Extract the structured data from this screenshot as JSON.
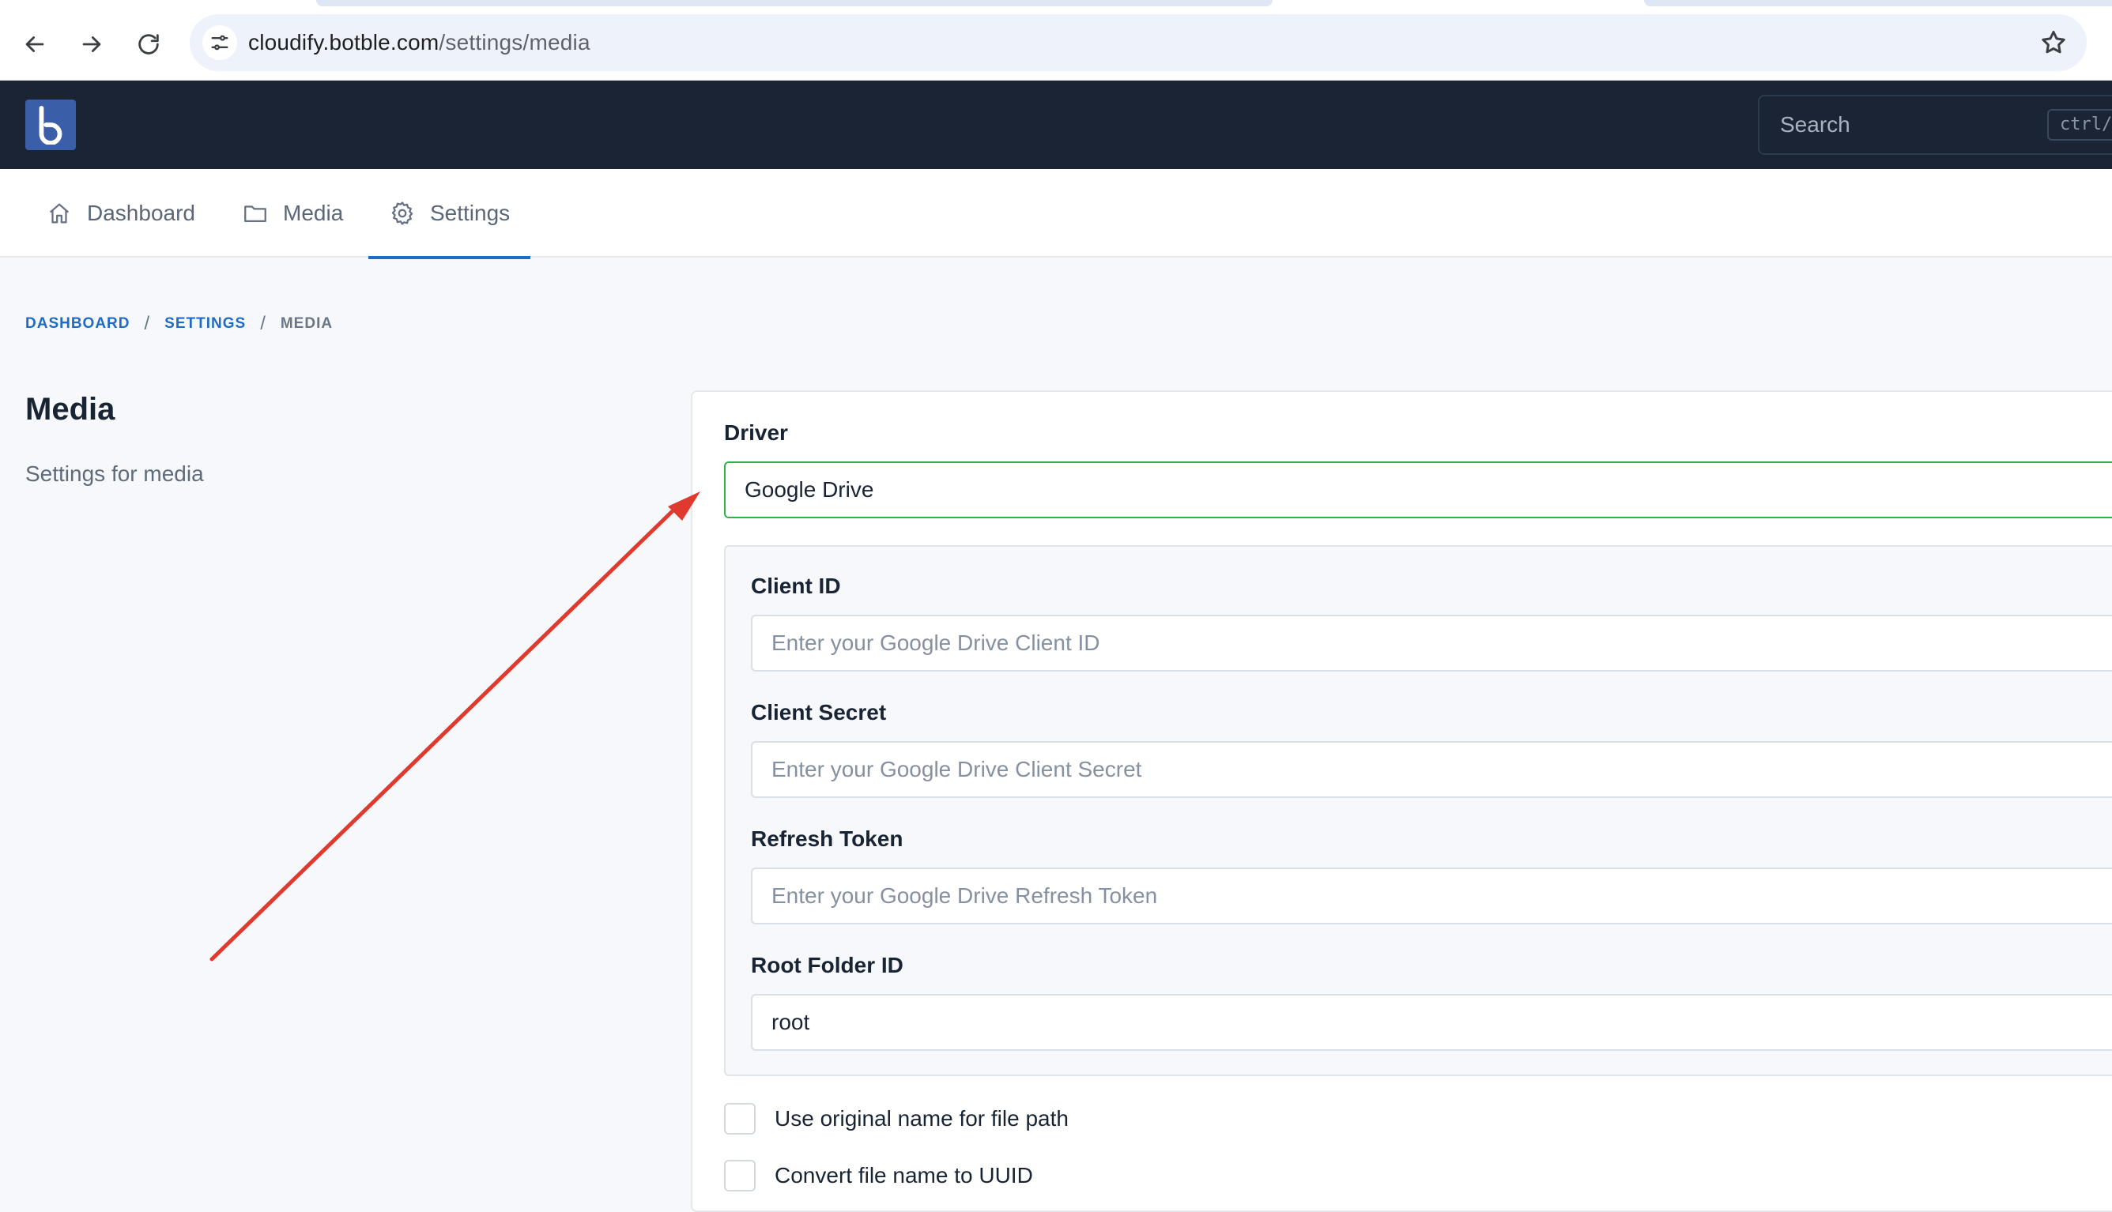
{
  "browser": {
    "url_host": "cloudify.botble.com",
    "url_path": "/settings/media"
  },
  "header": {
    "search_placeholder": "Search",
    "search_shortcut": "ctrl/"
  },
  "nav": {
    "items": [
      {
        "label": "Dashboard",
        "icon": "home-icon"
      },
      {
        "label": "Media",
        "icon": "folder-icon"
      },
      {
        "label": "Settings",
        "icon": "gear-icon",
        "active": true
      }
    ]
  },
  "breadcrumb": {
    "items": [
      "DASHBOARD",
      "SETTINGS",
      "MEDIA"
    ],
    "separator": "/"
  },
  "section": {
    "title": "Media",
    "description": "Settings for media"
  },
  "form": {
    "driver_label": "Driver",
    "driver_value": "Google Drive",
    "client_id_label": "Client ID",
    "client_id_placeholder": "Enter your Google Drive Client ID",
    "client_secret_label": "Client Secret",
    "client_secret_placeholder": "Enter your Google Drive Client Secret",
    "refresh_token_label": "Refresh Token",
    "refresh_token_placeholder": "Enter your Google Drive Refresh Token",
    "root_folder_label": "Root Folder ID",
    "root_folder_value": "root",
    "use_original_name_label": "Use original name for file path",
    "convert_uuid_label": "Convert file name to UUID"
  },
  "colors": {
    "header_bg": "#1b2434",
    "accent": "#206bc4",
    "focus_border": "#2fb344",
    "annotation_arrow": "#e03a2f"
  }
}
